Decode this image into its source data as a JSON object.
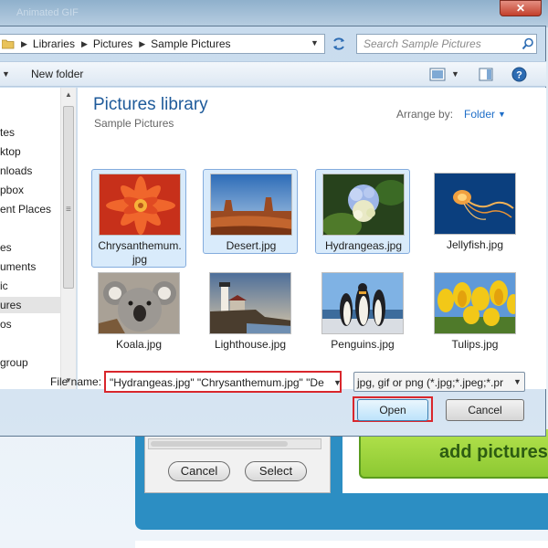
{
  "background": {
    "window_title": "Animated GIF",
    "scrollbar_present": true,
    "cancel_label": "Cancel",
    "select_label": "Select",
    "add_pictures_label": "add pictures"
  },
  "dialog": {
    "address": {
      "breadcrumbs": [
        "Libraries",
        "Pictures",
        "Sample Pictures"
      ]
    },
    "search": {
      "placeholder": "Search Sample Pictures"
    },
    "toolbar": {
      "new_folder_label": "New folder"
    },
    "nav": {
      "items": [
        {
          "label": "tes"
        },
        {
          "label": "ktop"
        },
        {
          "label": "nloads"
        },
        {
          "label": "pbox"
        },
        {
          "label": "ent Places"
        },
        {
          "label": "es"
        },
        {
          "label": "uments"
        },
        {
          "label": "ic"
        },
        {
          "label": "ures",
          "selected": true
        },
        {
          "label": "os"
        },
        {
          "label": "group"
        }
      ]
    },
    "library": {
      "title": "Pictures library",
      "subtitle": "Sample Pictures",
      "arrange_label": "Arrange by:",
      "arrange_value": "Folder"
    },
    "files": [
      {
        "name": "Chrysanthemum.\njpg",
        "name_line1": "Chrysanthemum.",
        "name_line2": "jpg",
        "selected": true,
        "icon": "chrysanthemum-image"
      },
      {
        "name_line1": "Desert.jpg",
        "selected": true,
        "icon": "desert-image"
      },
      {
        "name_line1": "Hydrangeas.jpg",
        "selected": true,
        "icon": "hydrangeas-image"
      },
      {
        "name_line1": "Jellyfish.jpg",
        "selected": false,
        "icon": "jellyfish-image"
      },
      {
        "name_line1": "Koala.jpg",
        "selected": false,
        "icon": "koala-image"
      },
      {
        "name_line1": "Lighthouse.jpg",
        "selected": false,
        "icon": "lighthouse-image"
      },
      {
        "name_line1": "Penguins.jpg",
        "selected": false,
        "icon": "penguins-image"
      },
      {
        "name_line1": "Tulips.jpg",
        "selected": false,
        "icon": "tulips-image"
      }
    ],
    "filename": {
      "label": "File name:",
      "value": "\"Hydrangeas.jpg\" \"Chrysanthemum.jpg\" \"De"
    },
    "filetype": {
      "value": "jpg, gif or png (*.jpg;*.jpeg;*.pr"
    },
    "buttons": {
      "open": "Open",
      "cancel": "Cancel"
    }
  },
  "colors": {
    "highlight_red": "#d9262c",
    "link_blue": "#1e6ec8",
    "title_blue": "#1e5a9a",
    "selection_fill": "#d9ebfb"
  }
}
